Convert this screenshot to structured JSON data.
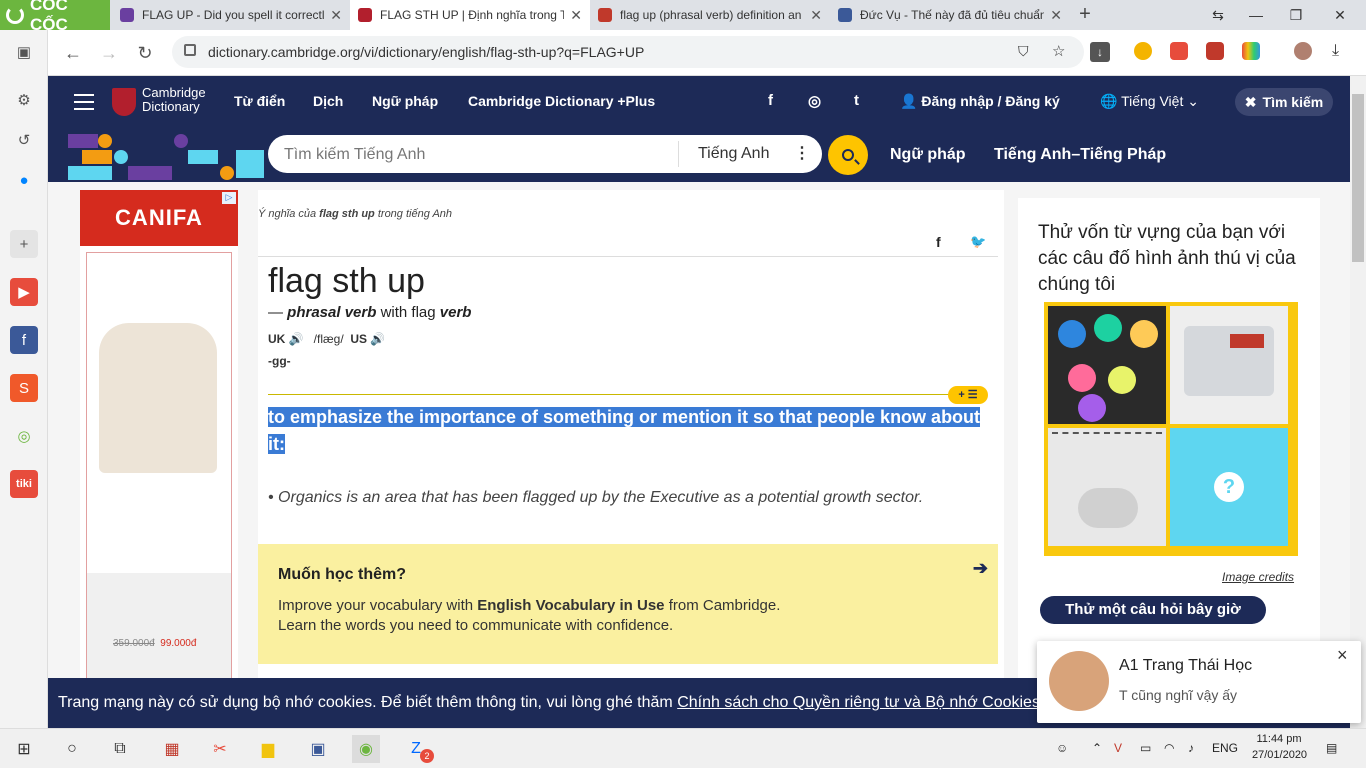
{
  "browser": {
    "brand": "CỐC CỐC",
    "tabs": [
      {
        "title": "FLAG UP - Did you spell it correctly?",
        "color": "#6a3fa0"
      },
      {
        "title": "FLAG STH UP | Định nghĩa trong T",
        "color": "#b21f2d",
        "active": true
      },
      {
        "title": "flag up (phrasal verb) definition an",
        "color": "#c0392b"
      },
      {
        "title": "Đức Vụ - Thế này đã đủ tiêu chuẩn",
        "color": "#3b5998"
      }
    ],
    "url": "dictionary.cambridge.org/vi/dictionary/english/flag-sth-up?q=FLAG+UP",
    "new_tab": "+"
  },
  "site": {
    "logo_line1": "Cambridge",
    "logo_line2": "Dictionary",
    "nav": [
      "Từ điển",
      "Dịch",
      "Ngữ pháp",
      "Cambridge Dictionary +Plus"
    ],
    "social": [
      "f",
      "◎",
      "t"
    ],
    "login": "Đăng nhập / Đăng ký",
    "language": "Tiếng Việt",
    "search_btn": "Tìm kiếm",
    "search_placeholder": "Tìm kiếm Tiếng Anh",
    "search_lang": "Tiếng Anh",
    "band_links": [
      "Ngữ pháp",
      "Tiếng Anh–Tiếng Pháp"
    ]
  },
  "ad": {
    "brand": "CANIFA",
    "old_price": "359.000đ",
    "new_price": "99.000đ"
  },
  "entry": {
    "crumb_prefix": "Ý nghĩa của",
    "crumb_word": "flag sth up",
    "crumb_suffix": "trong tiếng Anh",
    "headword": "flag sth up",
    "pos_dash": "—",
    "pos": "phrasal verb",
    "pos_with": "with flag",
    "pos_base": "verb",
    "uk": "UK",
    "ipa": "/flæɡ/",
    "us": "US",
    "inflection": "-gg-",
    "plus_btn": "+ ☰",
    "definition": "to emphasize the importance of something or mention it so that people know about it:",
    "example": "Organics is an area that has been flagged up by the Executive as a potential growth sector."
  },
  "promo": {
    "title": "Muốn học thêm?",
    "line1_a": "Improve your vocabulary with ",
    "line1_b": "English Vocabulary in Use",
    "line1_c": " from Cambridge.",
    "line2": "Learn the words you need to communicate with confidence."
  },
  "quiz": {
    "heading": "Thử vốn từ vựng của bạn với các câu đố hình ảnh thú vị của chúng tôi",
    "credits": "Image credits",
    "button": "Thử một câu hỏi bây giờ"
  },
  "cookie": {
    "text": "Trang mạng này có sử dụng bộ nhớ cookies. Để biết thêm thông tin, vui lòng ghé thăm ",
    "link": "Chính sách cho Quyền riêng tư và Bộ nhớ Cookies"
  },
  "notification": {
    "name": "A1 Trang Thái Học",
    "message": "T cũng nghĩ vậy ấy",
    "close": "×"
  },
  "taskbar": {
    "lang": "ENG",
    "time": "11:44 pm",
    "date": "27/01/2020",
    "badge": "2"
  }
}
